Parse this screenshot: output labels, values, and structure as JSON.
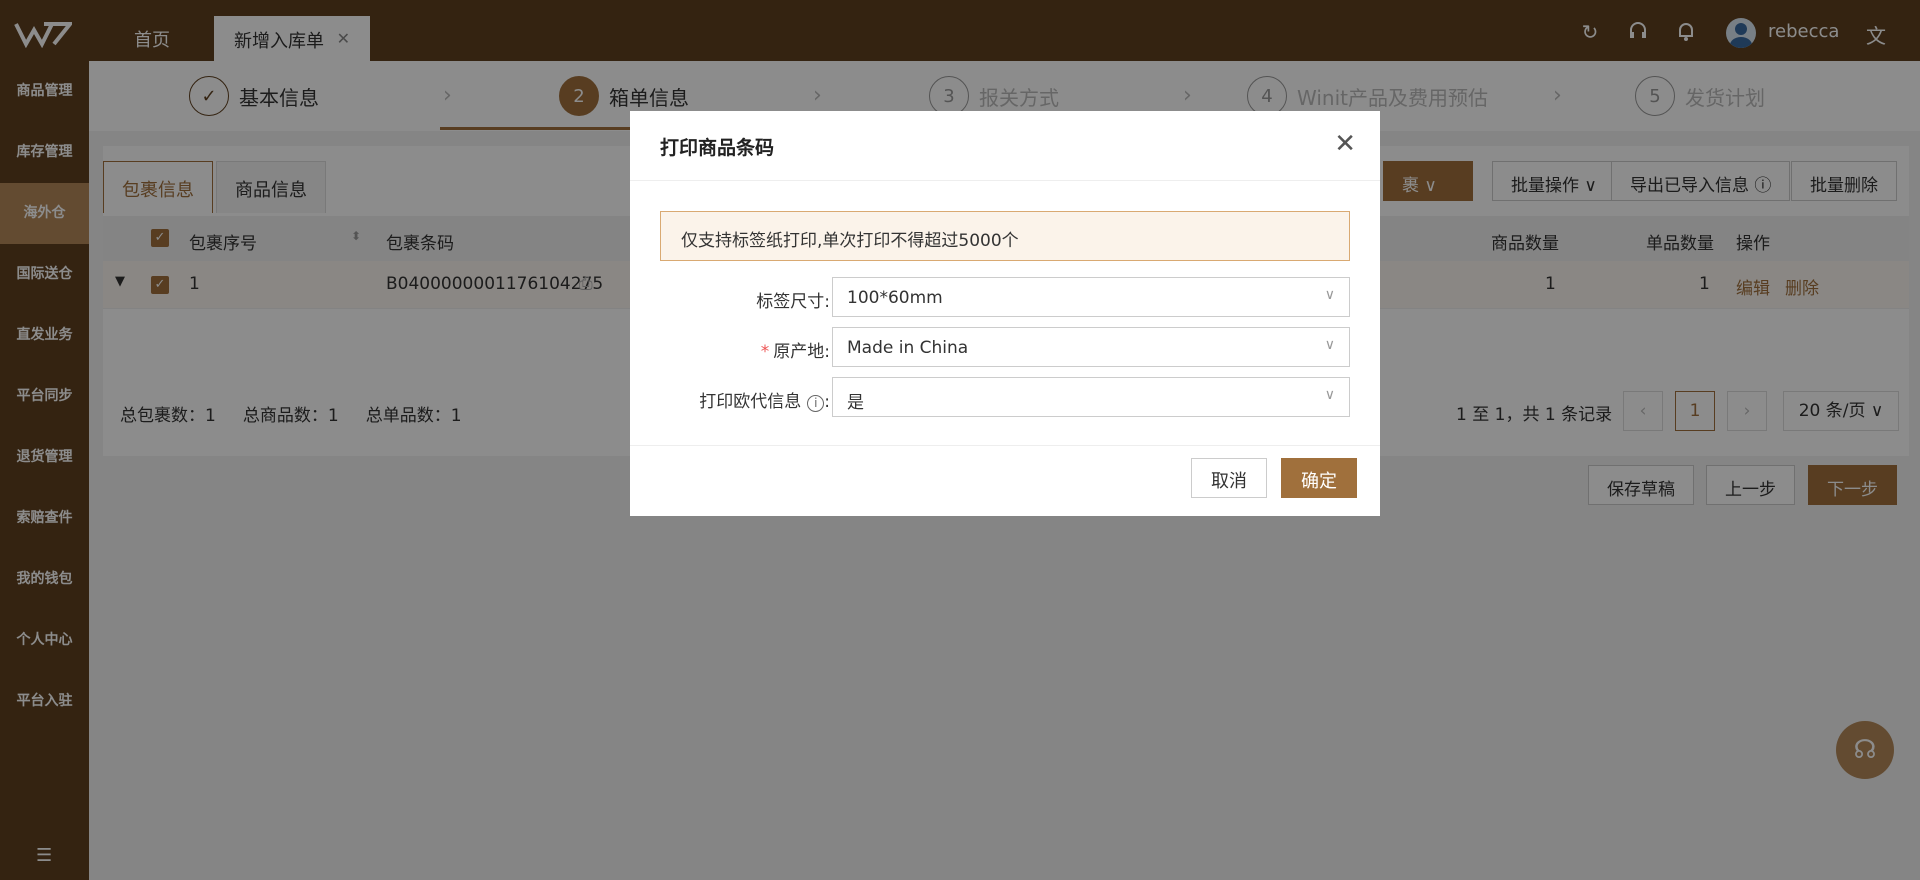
{
  "header": {
    "tabs": [
      {
        "label": "首页"
      },
      {
        "label": "新增入库单"
      }
    ],
    "username": "rebecca"
  },
  "sidebar": {
    "items": [
      {
        "label": "商品管理"
      },
      {
        "label": "库存管理"
      },
      {
        "label": "海外仓"
      },
      {
        "label": "国际送仓"
      },
      {
        "label": "直发业务"
      },
      {
        "label": "平台同步"
      },
      {
        "label": "退货管理"
      },
      {
        "label": "索赔查件"
      },
      {
        "label": "我的钱包"
      },
      {
        "label": "个人中心"
      },
      {
        "label": "平台入驻"
      }
    ]
  },
  "steps": [
    {
      "num": "✓",
      "label": "基本信息"
    },
    {
      "num": "2",
      "label": "箱单信息"
    },
    {
      "num": "3",
      "label": "报关方式"
    },
    {
      "num": "4",
      "label": "Winit产品及费用预估"
    },
    {
      "num": "5",
      "label": "发货计划"
    }
  ],
  "panel": {
    "subtabs": [
      "包裹信息",
      "商品信息"
    ],
    "actions": {
      "partial": "裹",
      "batch_ops": "批量操作",
      "export_imported": "导出已导入信息",
      "batch_delete": "批量删除"
    },
    "columns": {
      "seq": "包裹序号",
      "barcode": "包裹条码",
      "goods_qty": "商品数量",
      "unit_qty": "单品数量",
      "ops": "操作"
    },
    "rows": [
      {
        "seq": "1",
        "barcode": "B0400000001176104275",
        "goods_qty": "1",
        "unit_qty": "1",
        "edit": "编辑",
        "delete": "删除"
      }
    ],
    "summary": {
      "packages_label": "总包裹数：",
      "packages": "1",
      "goods_label": "总商品数：",
      "goods": "1",
      "units_label": "总单品数：",
      "units": "1"
    },
    "pager": {
      "text": "1 至 1，共 1 条记录",
      "page": "1",
      "page_size": "20 条/页"
    },
    "buttons": {
      "save_draft": "保存草稿",
      "prev": "上一步",
      "next": "下一步"
    }
  },
  "modal": {
    "title": "打印商品条码",
    "notice": "仅支持标签纸打印,单次打印不得超过5000个",
    "fields": [
      {
        "label": "标签尺寸:",
        "value": "100*60mm",
        "required": false
      },
      {
        "label": "原产地:",
        "value": "Made in China",
        "required": true
      },
      {
        "label": "打印欧代信息",
        "value": "是",
        "required": false
      }
    ],
    "cancel": "取消",
    "confirm": "确定"
  }
}
